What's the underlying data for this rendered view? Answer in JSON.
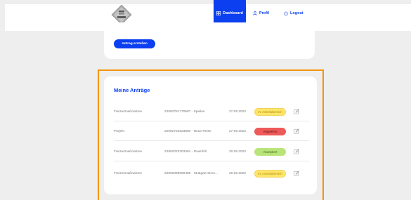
{
  "nav": {
    "dashboard_label": "Dashboard",
    "profil_label": "Profil",
    "logout_label": "Logout",
    "accent_color": "#0c3ff0"
  },
  "top_card": {
    "create_button_label": "Antrag erstellen"
  },
  "requests": {
    "title": "Meine Anträge",
    "rows": [
      {
        "type": "Freizeitmaßnahme",
        "name": "22092761770587 - Spielen",
        "date": "27.09.2022",
        "status": "Im Arbeitsbereich",
        "status_color": "yellow",
        "edit_icon": "edit-icon"
      },
      {
        "type": "Projekt",
        "name": "22092723623580 - Neue Reise",
        "date": "27.09.2022",
        "status": "Abgelehnt",
        "status_color": "red",
        "edit_icon": "edit-icon"
      },
      {
        "type": "Freizeitmaßnahme",
        "name": "22092023203491 - Downhill",
        "date": "20.09.2022",
        "status": "Akzeptiert",
        "status_color": "green",
        "edit_icon": "edit-icon"
      },
      {
        "type": "Freizeitmaßnahme",
        "name": "22092099060485 - Stuttgart Simo...",
        "date": "20.09.2022",
        "status": "Im Arbeitsbereich",
        "status_color": "yellow",
        "edit_icon": "edit-icon"
      }
    ]
  },
  "highlight_color": "#f5940f"
}
